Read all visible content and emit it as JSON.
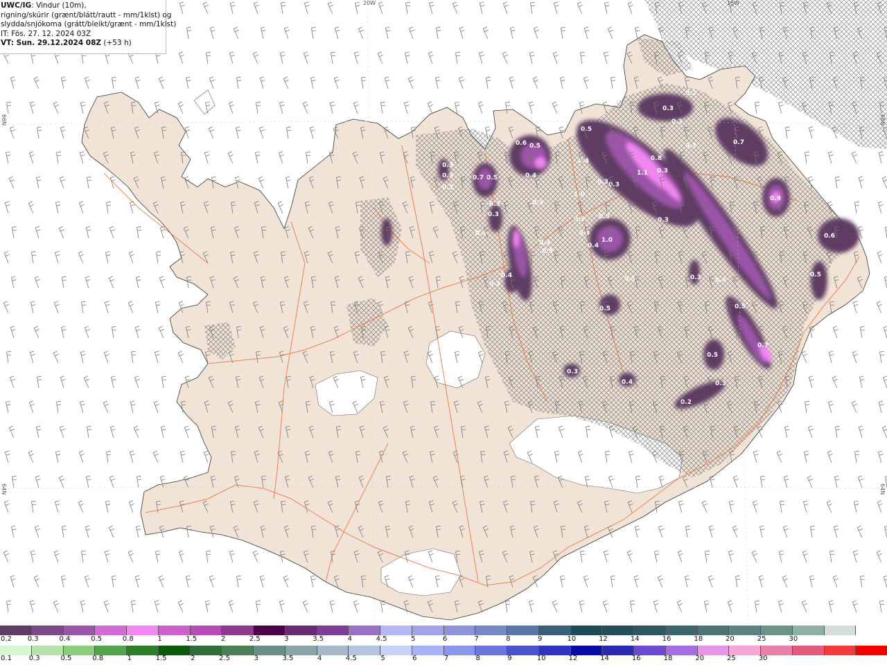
{
  "header": {
    "model": "UWC/IG",
    "line1_rest": ": Vindur (10m),",
    "line2": "rigning/skúrir (grænt/blátt/rautt - mm/1klst) og",
    "line3": "slydda/snjókoma (grátt/bleikt/grænt - mm/1klst)",
    "it": "IT: Fös. 27. 12. 2024 03Z",
    "vt_bold": "VT: Sun. 29.12.2024 08Z",
    "vt_rest": " (+53 h)"
  },
  "coords": {
    "top_20w": "20W",
    "top_15w": "15W",
    "left_66n": "66N",
    "left_64n": "64N",
    "right_66n": "66N",
    "right_64n": "64N"
  },
  "snow_labels": [
    {
      "v": "0.3"
    },
    {
      "v": "0.3"
    },
    {
      "v": "0.3"
    },
    {
      "v": "0.7"
    },
    {
      "v": "0.5"
    },
    {
      "v": "0.6"
    },
    {
      "v": "0.5"
    },
    {
      "v": "0.4"
    },
    {
      "v": "0.3"
    },
    {
      "v": "0.3"
    },
    {
      "v": "0.3"
    },
    {
      "v": "0.3"
    },
    {
      "v": "0.4"
    },
    {
      "v": "0.3"
    },
    {
      "v": "0.5"
    },
    {
      "v": "0.5"
    },
    {
      "v": "0.4"
    },
    {
      "v": "1.0"
    },
    {
      "v": "0.8"
    },
    {
      "v": "1.1"
    },
    {
      "v": "0.3"
    },
    {
      "v": "0.3"
    },
    {
      "v": "0.3"
    },
    {
      "v": "0.3"
    },
    {
      "v": "0.4"
    },
    {
      "v": "0.3"
    },
    {
      "v": "0.3"
    },
    {
      "v": "1.0"
    },
    {
      "v": "0.3"
    },
    {
      "v": "0.2"
    },
    {
      "v": "0.3"
    },
    {
      "v": "0.3"
    },
    {
      "v": "0.7"
    },
    {
      "v": "0.9"
    },
    {
      "v": "0.6"
    },
    {
      "v": "0.5"
    },
    {
      "v": "0.5"
    },
    {
      "v": "0.4"
    },
    {
      "v": "0.5"
    },
    {
      "v": "0.5"
    },
    {
      "v": "0.3"
    },
    {
      "v": "0.7"
    },
    {
      "v": "0.5"
    },
    {
      "v": "0.3"
    },
    {
      "v": "0.4"
    },
    {
      "v": "0.3"
    },
    {
      "v": "0.2"
    },
    {
      "v": "0.3"
    },
    {
      "v": "0.3"
    }
  ],
  "legend": {
    "snow_colors": [
      "#5e3c63",
      "#7c4a86",
      "#9b55a8",
      "#d26ad8",
      "#f287f2",
      "#cf5fcd",
      "#b64bb5",
      "#8e3a90",
      "#4c0046",
      "#6a2a73",
      "#7e3e96",
      "#9a70c6",
      "#b6b6f6",
      "#a2a2e9",
      "#8e92d7",
      "#7788c4",
      "#5876a6",
      "#3a6078",
      "#1c4a57",
      "#244f5a",
      "#2c5660",
      "#3c656c",
      "#4c7476",
      "#5c837f",
      "#6c9289",
      "#8eb0a8",
      "#d4dcdc",
      "#ffffff"
    ],
    "snow_labels": [
      "0.2",
      "0.3",
      "0.4",
      "0.5",
      "0.8",
      "1",
      "1.5",
      "2",
      "2.5",
      "3",
      "3.5",
      "4",
      "4.5",
      "5",
      "6",
      "7",
      "8",
      "9",
      "10",
      "12",
      "14",
      "16",
      "18",
      "20",
      "25",
      "30"
    ],
    "rain_colors": [
      "#d8f7d0",
      "#b6e3aa",
      "#8acd7d",
      "#52a54a",
      "#2e7f2a",
      "#0a5a0a",
      "#2f6e3a",
      "#4b7f55",
      "#6a8f88",
      "#8aa4a8",
      "#a6b8c8",
      "#b6c4e4",
      "#c6d2f8",
      "#a6b2f4",
      "#8a96ea",
      "#6a76de",
      "#4a52cc",
      "#3232c0",
      "#0a0aa6",
      "#2a2ab4",
      "#6a4ad2",
      "#a66ee6",
      "#e696e8",
      "#f6a6d4",
      "#ec7fa8",
      "#e25a7a",
      "#f23a3a",
      "#f70000"
    ],
    "rain_labels": [
      "0.1",
      "0.3",
      "0.5",
      "0.8",
      "1",
      "1.5",
      "2",
      "2.5",
      "3",
      "3.5",
      "4",
      "4.5",
      "5",
      "6",
      "7",
      "8",
      "9",
      "10",
      "12",
      "14",
      "16",
      "18",
      "20",
      "25",
      "30"
    ]
  }
}
